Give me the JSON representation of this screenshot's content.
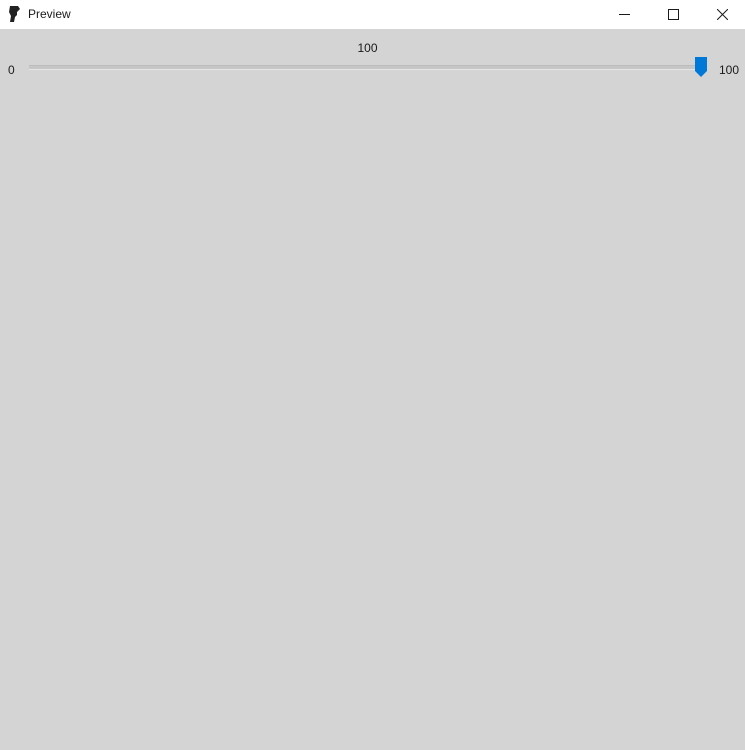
{
  "window": {
    "title": "Preview",
    "icon": "app-logo-icon",
    "controls": [
      "minimize-icon",
      "maximize-icon",
      "close-icon"
    ]
  },
  "slider": {
    "value_label": "100",
    "min_label": "0",
    "max_label": "100",
    "value": 1.0,
    "thumb_color": "#0078d7"
  },
  "colors": {
    "background": "#d4d4d4",
    "titlebar": "#ffffff",
    "accent": "#0078d7"
  }
}
